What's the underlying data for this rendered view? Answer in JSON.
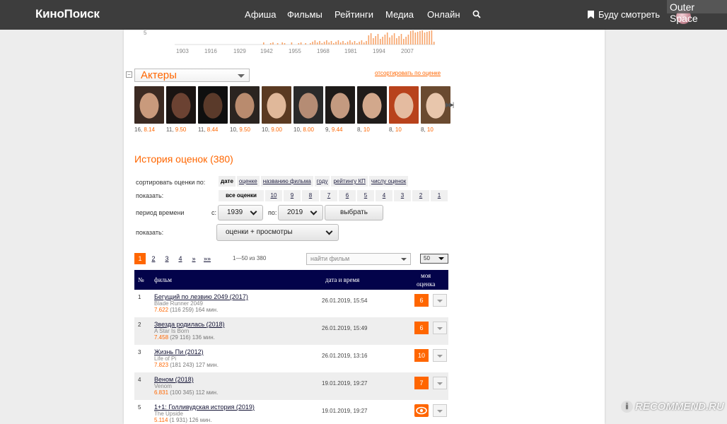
{
  "topbar": {
    "logo": "КиноПоиск",
    "nav": [
      "Афиша",
      "Фильмы",
      "Рейтинги",
      "Медиа",
      "Онлайн"
    ],
    "watch_later": "Буду смотреть",
    "user_name": "Outer Space"
  },
  "mini_chart": {
    "y_tick": "5",
    "years": [
      "1903",
      "1916",
      "1929",
      "1942",
      "1955",
      "1968",
      "1981",
      "1994",
      "2007"
    ]
  },
  "actors": {
    "toggle": "−",
    "select_label": "Актеры",
    "sort_link": "отсортировать по оценке",
    "list": [
      {
        "count": "16",
        "rating": "8.14",
        "colors": [
          "#3b2a22",
          "#c99a7c"
        ]
      },
      {
        "count": "11",
        "rating": "9.50",
        "colors": [
          "#1a1412",
          "#6b4232"
        ]
      },
      {
        "count": "11",
        "rating": "8.44",
        "colors": [
          "#0f0f0f",
          "#5a3a2a"
        ]
      },
      {
        "count": "10",
        "rating": "9.50",
        "colors": [
          "#2b2420",
          "#b98b6e"
        ]
      },
      {
        "count": "10",
        "rating": "9.00",
        "colors": [
          "#5a3a22",
          "#e0b89a"
        ]
      },
      {
        "count": "10",
        "rating": "8.00",
        "colors": [
          "#2a2a2a",
          "#b58c74"
        ]
      },
      {
        "count": "9",
        "rating": "9.44",
        "colors": [
          "#1e1a18",
          "#c49a80"
        ]
      },
      {
        "count": "8",
        "rating": "10",
        "colors": [
          "#201c1a",
          "#d2a88c"
        ]
      },
      {
        "count": "8",
        "rating": "10",
        "colors": [
          "#b8421c",
          "#e4bba0"
        ]
      },
      {
        "count": "8",
        "rating": "10",
        "colors": [
          "#6a4a30",
          "#e8c6ac"
        ]
      }
    ]
  },
  "history": {
    "title": "История оценок (380)",
    "sort_label": "сортировать оценки по:",
    "sort_options": [
      "дате",
      "оценке",
      "названию фильма",
      "году",
      "рейтингу КП",
      "числу оценок"
    ],
    "show_label": "показать:",
    "show_options": [
      "все оценки",
      "10",
      "9",
      "8",
      "7",
      "6",
      "5",
      "4",
      "3",
      "2",
      "1"
    ],
    "period_label": "период времени",
    "from_label": "с:",
    "from_value": "1939",
    "to_label": "по:",
    "to_value": "2019",
    "choose_button": "выбрать",
    "show2_label": "показать:",
    "show2_value": "оценки + просмотры"
  },
  "pager": {
    "pages": [
      "1",
      "2",
      "3",
      "4",
      "»",
      "»»"
    ],
    "count": "1—50 из 380",
    "find_placeholder": "найти фильм",
    "per_page": "50"
  },
  "table": {
    "headers": {
      "num": "№",
      "film": "фильм",
      "date": "дата и время",
      "my_rating_1": "моя",
      "my_rating_2": "оценка"
    },
    "rows": [
      {
        "num": "1",
        "title": "Бегущий по лезвию 2049 (2017)",
        "original": "Blade Runner 2049",
        "rating": "7.622",
        "votes_len": "(116 259) 164 мин.",
        "date": "26.01.2019, 15:54",
        "score": "6"
      },
      {
        "num": "2",
        "title": "Звезда родилась (2018)",
        "original": "A Star Is Born",
        "rating": "7.458",
        "votes_len": "(29 116) 136 мин.",
        "date": "26.01.2019, 15:49",
        "score": "6"
      },
      {
        "num": "3",
        "title": "Жизнь Пи (2012)",
        "original": "Life of Pi",
        "rating": "7.823",
        "votes_len": "(181 243) 127 мин.",
        "date": "26.01.2019, 13:16",
        "score": "10"
      },
      {
        "num": "4",
        "title": "Веном (2018)",
        "original": "Venom",
        "rating": "6.831",
        "votes_len": "(100 345) 112 мин.",
        "date": "19.01.2019, 19:27",
        "score": "7"
      },
      {
        "num": "5",
        "title": "1+1: Голливудская история (2019)",
        "original": "The Upside",
        "rating": "5.114",
        "votes_len": "(1 931) 126 мин.",
        "date": "19.01.2019, 19:27",
        "score": ""
      }
    ]
  },
  "watermark": {
    "badge": "i",
    "text": "RECOMMEND.RU"
  }
}
